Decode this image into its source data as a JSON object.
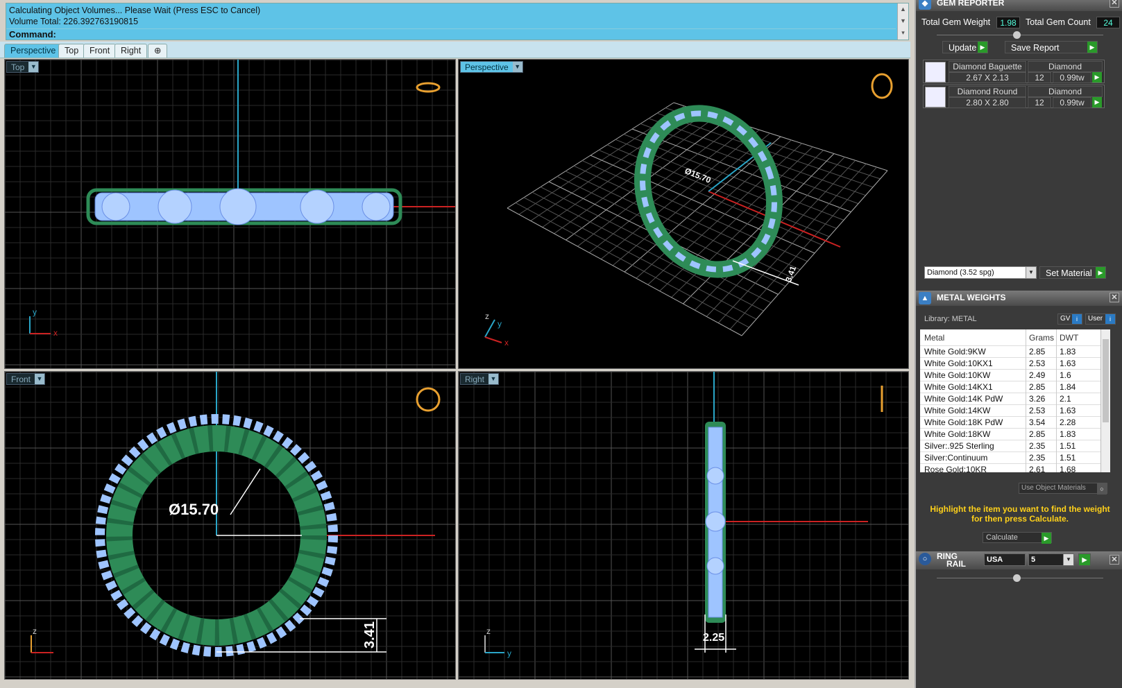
{
  "command": {
    "history_line1": "Calculating Object Volumes... Please Wait (Press ESC to Cancel)",
    "history_line2": "Volume Total: 226.392763190815",
    "prompt": "Command:"
  },
  "tabs": [
    "Perspective",
    "Top",
    "Front",
    "Right",
    "⊕"
  ],
  "viewports": {
    "top": "Top",
    "perspective": "Perspective",
    "front": "Front",
    "right": "Right"
  },
  "dimensions": {
    "diameter": "Ø15.70",
    "height": "3.41",
    "width": "2.25"
  },
  "axes": {
    "x": "x",
    "y": "y",
    "z": "z"
  },
  "gem_reporter": {
    "title": "GEM REPORTER",
    "total_weight_label": "Total Gem Weight",
    "total_weight": "1.98",
    "total_count_label": "Total Gem Count",
    "total_count": "24",
    "update_label": "Update",
    "save_label": "Save Report",
    "gems": [
      {
        "name": "Diamond Baguette",
        "material": "Diamond",
        "size": "2.67 X 2.13",
        "count": "12",
        "weight": "0.99tw"
      },
      {
        "name": "Diamond Round",
        "material": "Diamond",
        "size": "2.80 X 2.80",
        "count": "12",
        "weight": "0.99tw"
      }
    ],
    "material_select": "Diamond    (3.52 spg)",
    "set_material_label": "Set Material"
  },
  "metal_weights": {
    "title": "METAL WEIGHTS",
    "library": "Library: METAL",
    "gv_label": "GV",
    "user_label": "User",
    "headers": [
      "Metal",
      "Grams",
      "DWT"
    ],
    "rows": [
      [
        "White Gold:9KW",
        "2.85",
        "1.83"
      ],
      [
        "White Gold:10KX1",
        "2.53",
        "1.63"
      ],
      [
        "White Gold:10KW",
        "2.49",
        "1.6"
      ],
      [
        "White Gold:14KX1",
        "2.85",
        "1.84"
      ],
      [
        "White Gold:14K PdW",
        "3.26",
        "2.1"
      ],
      [
        "White Gold:14KW",
        "2.53",
        "1.63"
      ],
      [
        "White Gold:18K PdW",
        "3.54",
        "2.28"
      ],
      [
        "White Gold:18KW",
        "2.85",
        "1.83"
      ],
      [
        "Silver:.925 Sterling",
        "2.35",
        "1.51"
      ],
      [
        "Silver:Continuum",
        "2.35",
        "1.51"
      ],
      [
        "Rose Gold:10KR",
        "2.61",
        "1.68"
      ]
    ],
    "use_object_materials": "Use Object Materials",
    "hint": "Highlight the item you want to find the weight for then press Calculate.",
    "calculate_label": "Calculate"
  },
  "ring_rail": {
    "title_line1": "RING",
    "title_line2": "RAIL",
    "region": "USA",
    "size": "5"
  },
  "colors": {
    "accent": "#5ec3e7",
    "prong_green": "#2e8b57",
    "gem_blue": "#9ec4ff",
    "axis_red": "#cc2222",
    "axis_cyan": "#2aa6c8"
  }
}
